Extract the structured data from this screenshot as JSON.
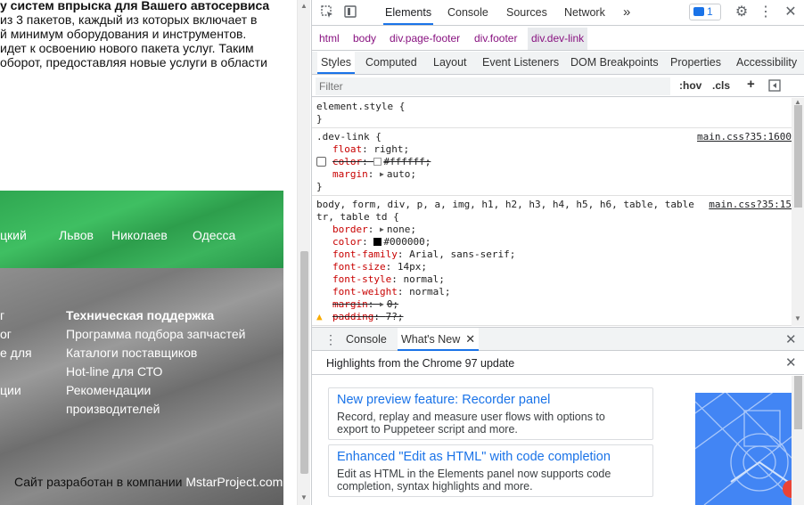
{
  "site": {
    "intro": {
      "heading": "у систем впрыска для Вашего автосервиса",
      "lines": [
        "из 3 пакетов, каждый из которых включает в",
        "й минимум оборудования и инструментов.",
        "идет к освоению нового пакета услуг. Таким",
        "оборот, предоставляя новые услуги в области"
      ]
    },
    "cities": [
      "цкий",
      "Львов",
      "Николаев",
      "Одесса"
    ],
    "footer": {
      "left_col": [
        "г",
        "ог",
        "е для",
        "ции"
      ],
      "support_title": "Техническая поддержка",
      "support_links": [
        "Программа подбора запчастей",
        "Каталоги поставщиков",
        "Hot-line для СТО",
        "Рекомендации",
        "производителей"
      ],
      "copyright_text": "Сайт разработан в компании ",
      "developer": "MstarProject.com"
    }
  },
  "devtools": {
    "tabs": [
      "Elements",
      "Console",
      "Sources",
      "Network"
    ],
    "more_tabs": "»",
    "issues_count": "1",
    "breadcrumbs": [
      "html",
      "body",
      "div.page-footer",
      "div.footer",
      "div.dev-link"
    ],
    "subtabs": [
      "Styles",
      "Computed",
      "Layout",
      "Event Listeners",
      "DOM Breakpoints",
      "Properties",
      "Accessibility"
    ],
    "filter_placeholder": "Filter",
    "hov": ":hov",
    "cls": ".cls",
    "plus": "+",
    "rules": {
      "element_style": {
        "open": "element.style {",
        "close": "}"
      },
      "dev_link": {
        "selector": ".dev-link {",
        "source": "main.css?35:1600",
        "float_name": "float",
        "float_value": "right;",
        "color_name": "color",
        "color_value": "#ffffff;",
        "margin_name": "margin",
        "margin_value": "auto;",
        "close": "}"
      },
      "reset": {
        "selector_line1": "body, form, div, p, a, img, h1, h2, h3, h4, h5, h6, table, table",
        "selector_line2": "tr, table td {",
        "source": "main.css?35:15",
        "border_name": "border",
        "border_value": "none;",
        "color_name": "color",
        "color_value": "#000000;",
        "ff_name": "font-family",
        "ff_value": "Arial, sans-serif;",
        "fs_name": "font-size",
        "fs_value": "14px;",
        "fst_name": "font-style",
        "fst_value": "normal;",
        "fw_name": "font-weight",
        "fw_value": "normal;",
        "margin_name": "margin",
        "margin_value": "0;",
        "padding_name": "padding",
        "padding_value": "7?;"
      }
    },
    "drawer": {
      "tabs": [
        "Console",
        "What's New"
      ],
      "header": "Highlights from the Chrome 97 update",
      "cards": [
        {
          "title": "New preview feature: Recorder panel",
          "desc_line1": "Record, replay and measure user flows with options to",
          "desc_line2": "export to Puppeteer script and more."
        },
        {
          "title": "Enhanced \"Edit as HTML\" with code completion",
          "desc_line1": "Edit as HTML in the Elements panel now supports code",
          "desc_line2": "completion, syntax highlights and more."
        }
      ]
    },
    "colors": {
      "accent": "#1a73e8",
      "tag": "#881280",
      "prop": "#c80000",
      "promo": "#4285f4"
    }
  }
}
